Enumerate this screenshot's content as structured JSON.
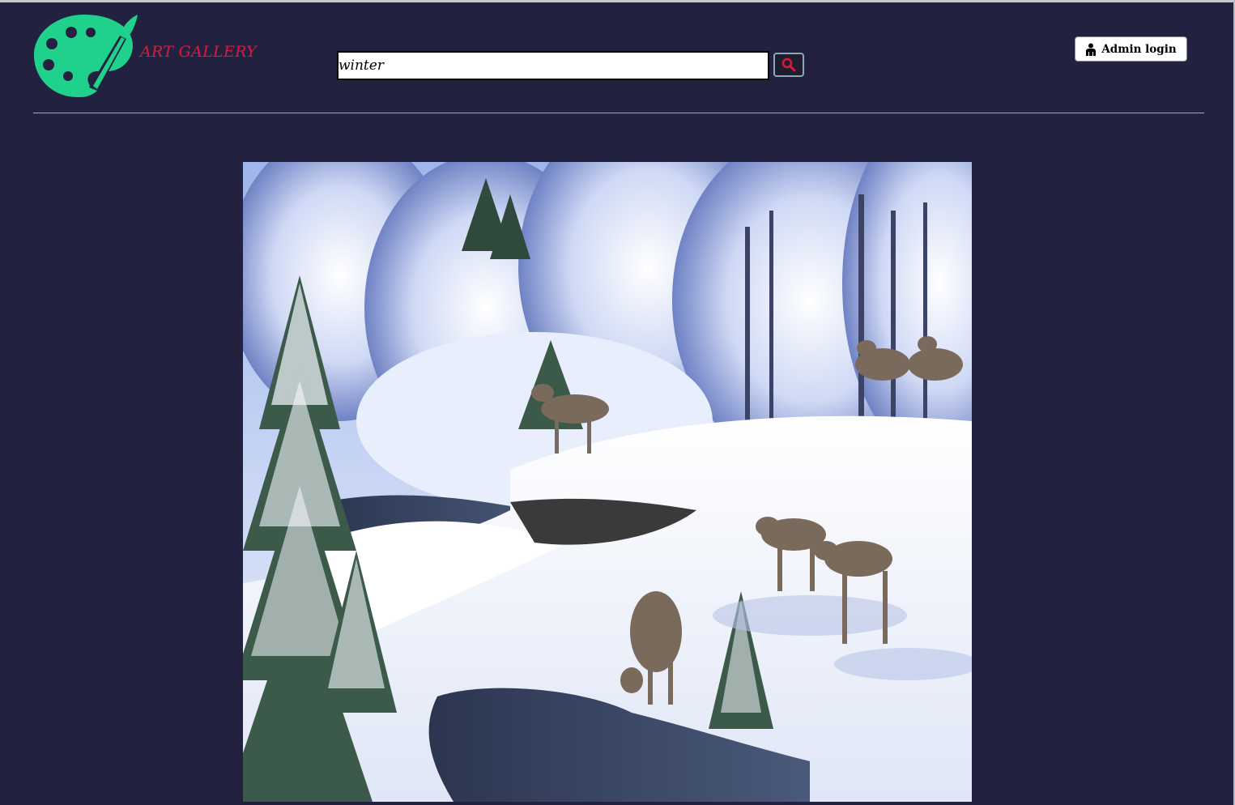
{
  "header": {
    "brand": "ART GALLERY",
    "logo_icon": "palette-brush-icon",
    "logo_color": "#1fd18a"
  },
  "search": {
    "value": "winter",
    "button_icon": "search-icon"
  },
  "admin": {
    "label": "Admin login",
    "icon": "user-icon"
  },
  "artwork": {
    "subject": "wolves-in-snowy-forest"
  },
  "colors": {
    "background": "#222240",
    "brand_text": "#e0163d",
    "search_icon": "#e0163d"
  }
}
